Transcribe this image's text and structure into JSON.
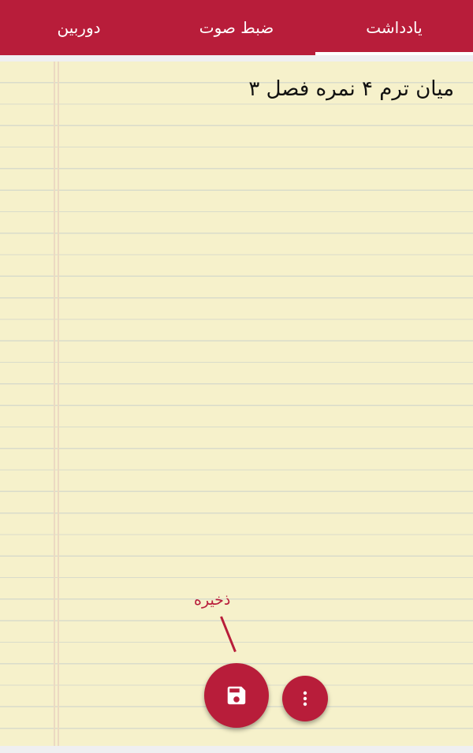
{
  "tabs": [
    {
      "label": "دوربین",
      "active": false
    },
    {
      "label": "ضبط صوت",
      "active": false
    },
    {
      "label": "یادداشت",
      "active": true
    }
  ],
  "note": {
    "content": "میان ترم ۴ نمره فصل ۳"
  },
  "actions": {
    "save_label": "ذخیره",
    "save_icon": "floppy-disk-icon",
    "more_icon": "more-vertical-icon"
  },
  "colors": {
    "accent": "#b81d3a",
    "paper": "#f6f1cb"
  }
}
